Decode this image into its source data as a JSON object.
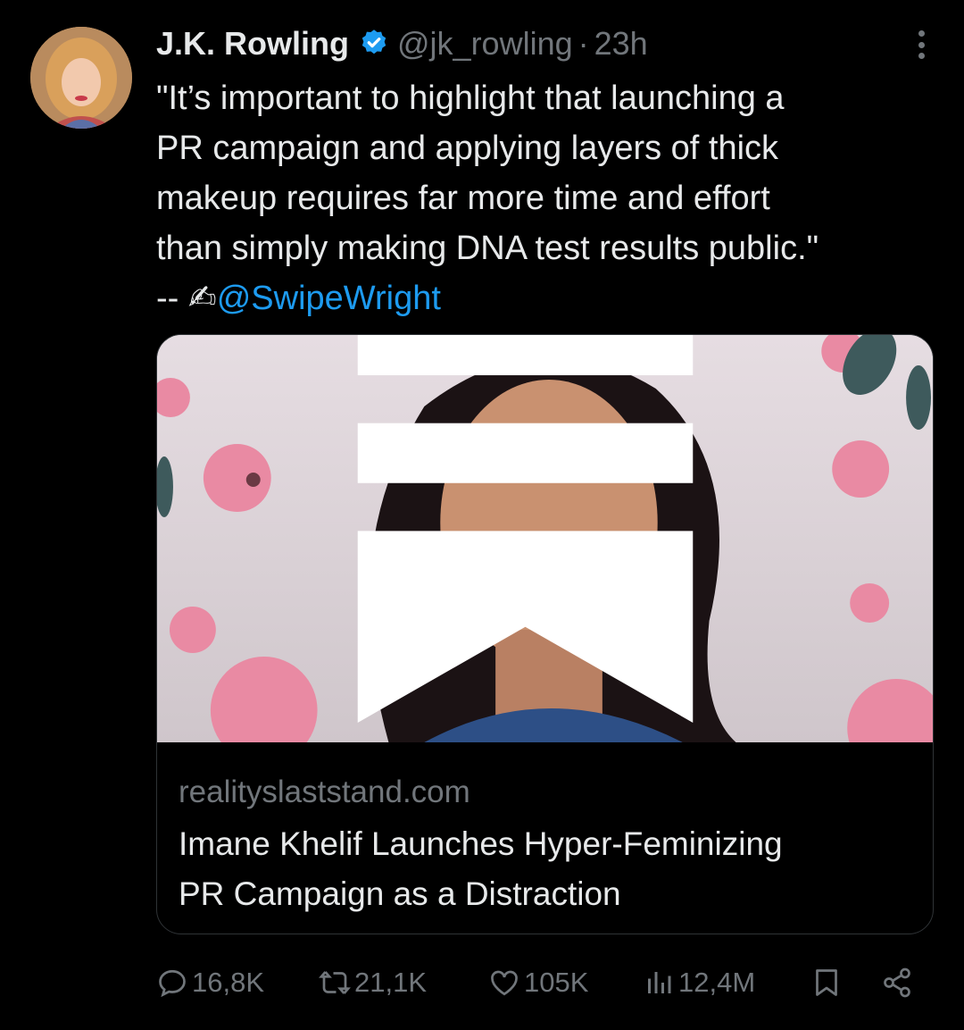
{
  "author": {
    "display_name": "J.K. Rowling",
    "handle": "@jk_rowling",
    "separator": "·",
    "time": "23h",
    "verified": true
  },
  "tweet": {
    "lines": [
      "\"It’s important to highlight that launching a",
      "PR campaign and applying layers of thick",
      "makeup requires far more time and effort",
      "than simply making DNA test results public.\""
    ],
    "attribution_prefix": "-- ✍",
    "attribution_mention": "@SwipeWright"
  },
  "card": {
    "domain": "realityslaststand.com",
    "title_lines": [
      "Imane Khelif Launches Hyper-Feminizing",
      "PR Campaign as a Distraction"
    ],
    "image_icon": "article-icon"
  },
  "actions": {
    "replies": "16,8K",
    "retweets": "21,1K",
    "likes": "105K",
    "views": "12,4M"
  },
  "colors": {
    "background": "#000000",
    "text": "#e7e9ea",
    "muted": "#71767b",
    "link": "#1d9bf0",
    "border": "#2f3336"
  },
  "icons": [
    "more-icon",
    "verified-icon",
    "reply-icon",
    "retweet-icon",
    "like-icon",
    "views-icon",
    "bookmark-icon",
    "share-icon"
  ]
}
